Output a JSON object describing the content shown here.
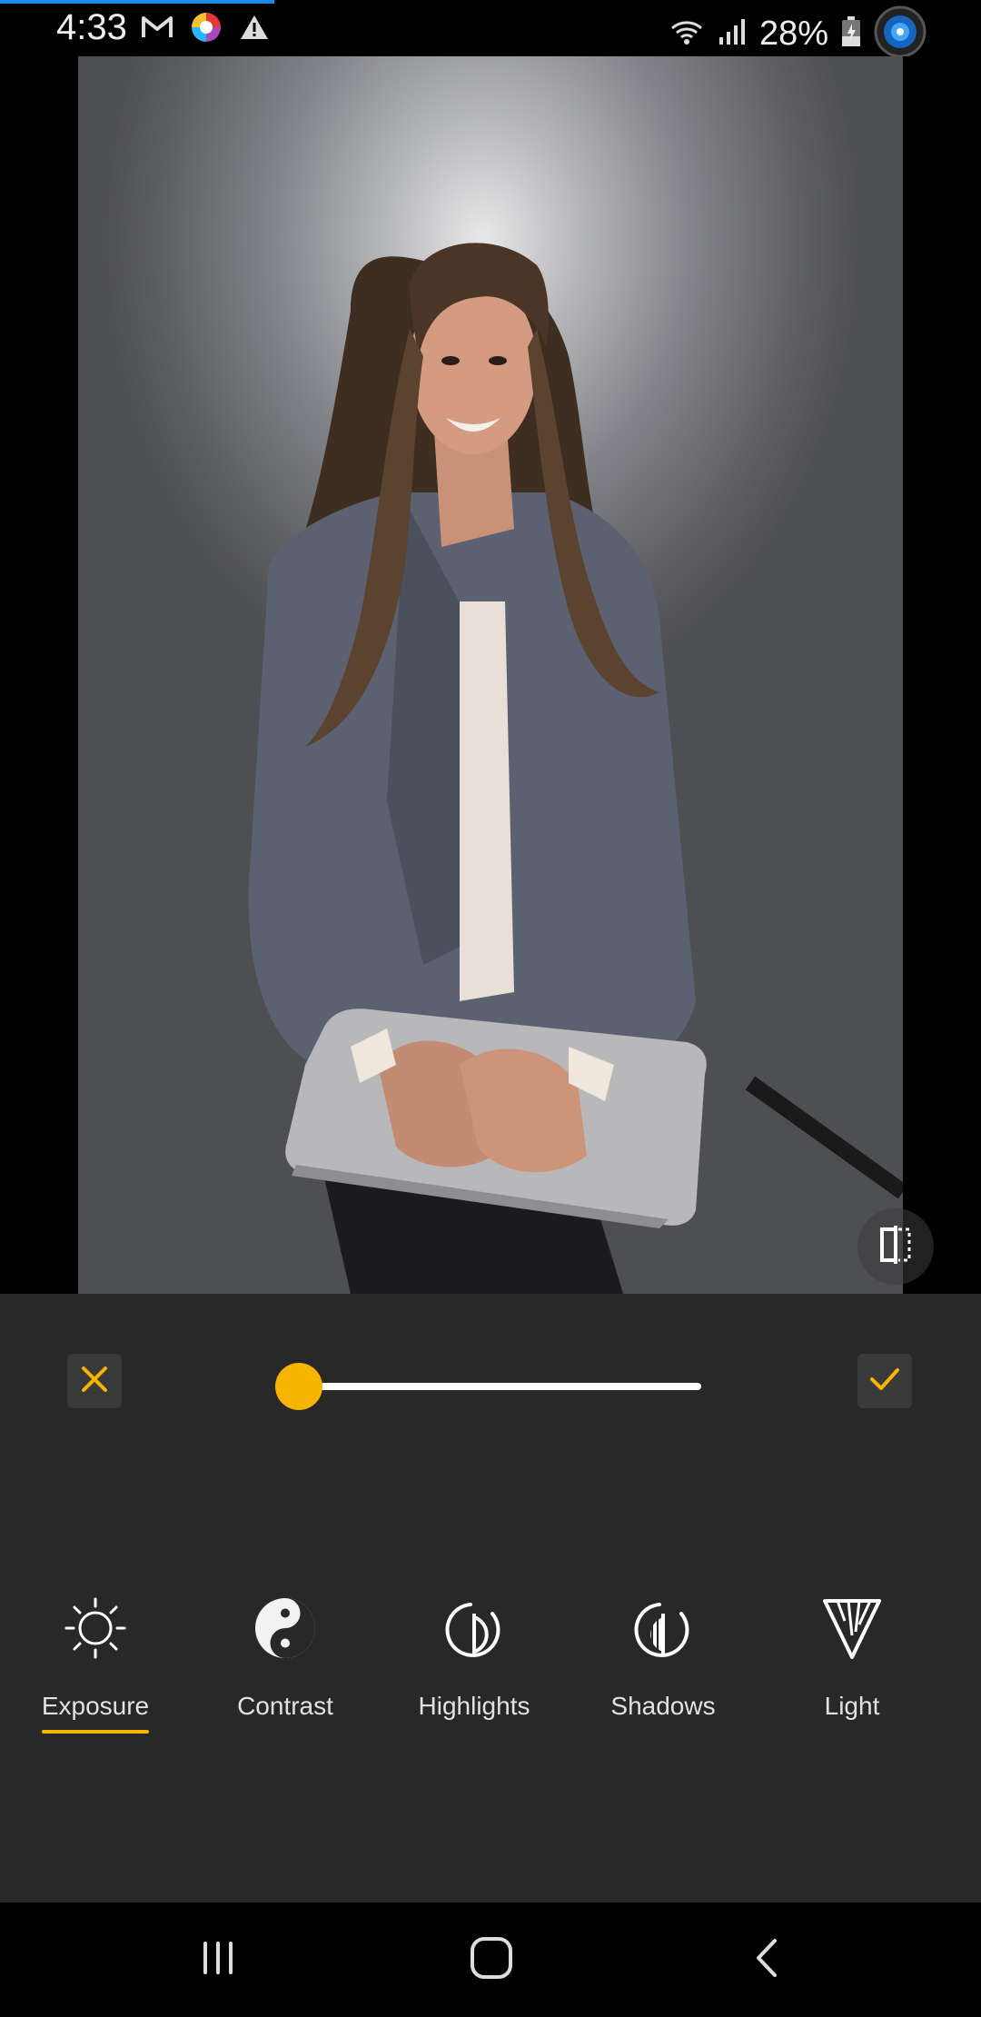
{
  "status_bar": {
    "time": "4:33",
    "battery": "28%",
    "left_icons": [
      "gmail-icon",
      "colorful-app-icon",
      "alert-icon"
    ],
    "right_icons": [
      "wifi-icon",
      "signal-icon",
      "battery-icon",
      "assistant-icon"
    ]
  },
  "editor": {
    "photo_subject": "portrait-photo",
    "compare_icon": "compare-icon"
  },
  "adjust_panel": {
    "cancel_icon": "close-icon",
    "confirm_icon": "check-icon",
    "slider_value_fraction": 0.02,
    "accent_color": "#f7b500",
    "panel_color": "#282828"
  },
  "tools": [
    {
      "label": "Exposure",
      "icon": "sun-icon",
      "selected": true
    },
    {
      "label": "Contrast",
      "icon": "yin-yang-icon",
      "selected": false
    },
    {
      "label": "Highlights",
      "icon": "highlights-icon",
      "selected": false
    },
    {
      "label": "Shadows",
      "icon": "shadows-icon",
      "selected": false
    },
    {
      "label": "Light",
      "icon": "light-icon",
      "selected": false
    }
  ],
  "nav_bar": {
    "recent_icon": "recent-apps-icon",
    "home_icon": "home-icon",
    "back_icon": "back-icon"
  }
}
